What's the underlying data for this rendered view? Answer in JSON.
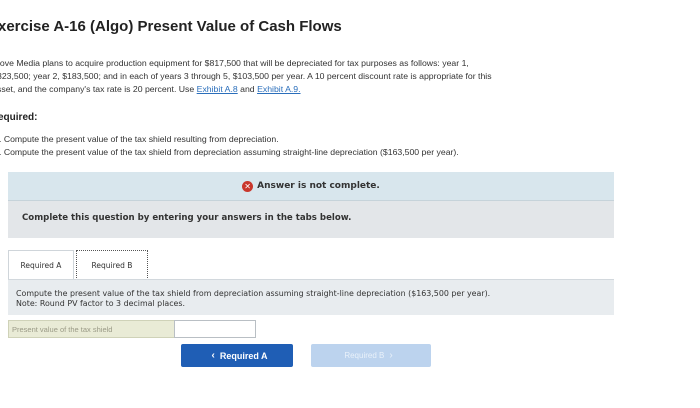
{
  "header": {
    "title": "xercise A-16 (Algo) Present Value of Cash Flows"
  },
  "intro": {
    "line1": "rove Media plans to acquire production equipment for $817,500 that will be depreciated for tax purposes as follows: year 1,",
    "line2": "323,500; year 2, $183,500; and in each of years 3 through 5, $103,500 per year. A 10 percent discount rate is appropriate for this",
    "line3_prefix": "sset, and the company's tax rate is 20 percent. Use",
    "exhibit_a8": "Exhibit A.8",
    "and": "and",
    "exhibit_a9": "Exhibit A.9."
  },
  "required": {
    "heading": "equired:",
    "items": [
      ". Compute the present value of the tax shield resulting from depreciation.",
      ". Compute the present value of the tax shield from depreciation assuming straight-line depreciation ($163,500 per year)."
    ]
  },
  "status": {
    "icon": "x-circle-icon",
    "text": "Answer is not complete."
  },
  "instruction": "Complete this question by entering your answers in the tabs below.",
  "tabs": [
    {
      "label": "Required A",
      "active": false
    },
    {
      "label": "Required B",
      "active": true
    }
  ],
  "content": {
    "question": "Compute the present value of the tax shield from depreciation assuming straight-line depreciation ($163,500 per year).",
    "note": "Note: Round PV factor to 3 decimal places."
  },
  "answer_field": {
    "label": "Present value of the tax shield",
    "value": ""
  },
  "nav": {
    "prev_label": "Required A",
    "next_label": "Required B"
  },
  "colors": {
    "primary_button": "#1f5eb5",
    "disabled_button": "#bcd3ee",
    "error_icon": "#c9372c",
    "status_bar": "#d8e6ed",
    "panel": "#e3e6e9"
  }
}
